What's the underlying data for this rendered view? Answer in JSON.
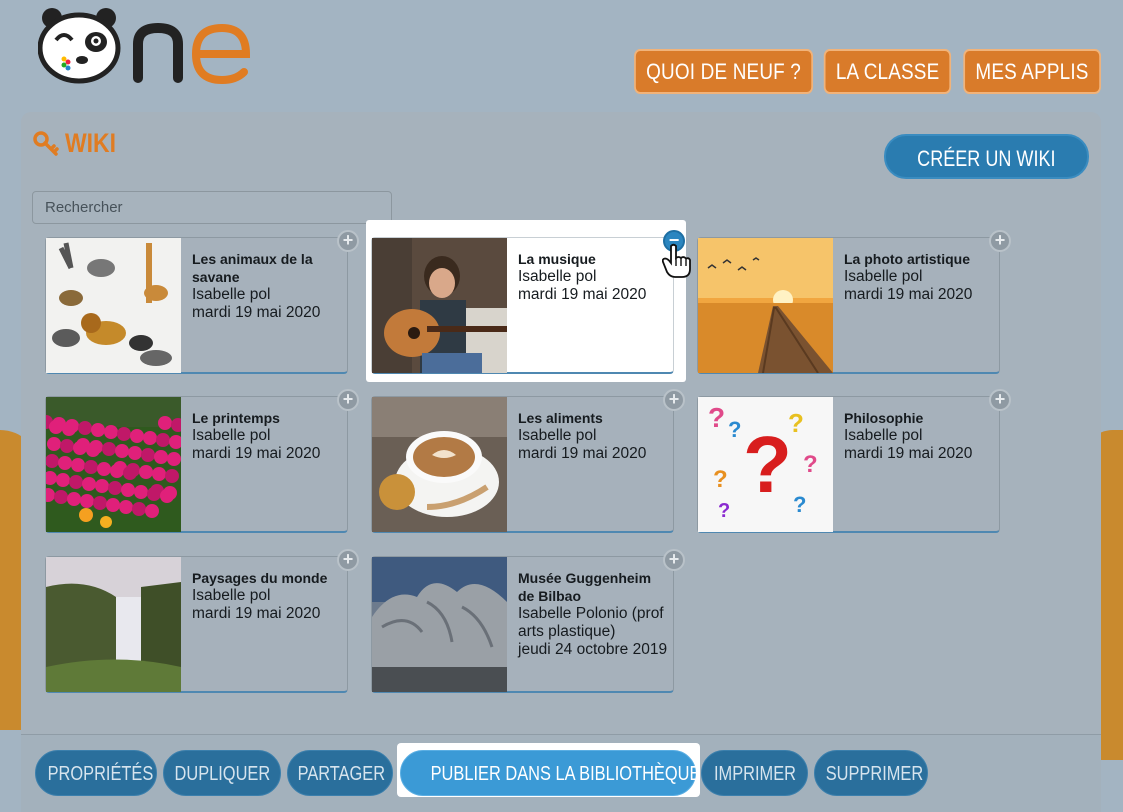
{
  "logo": {
    "text": "One"
  },
  "nav": [
    {
      "label": "QUOI DE NEUF ?"
    },
    {
      "label": "LA CLASSE"
    },
    {
      "label": "MES APPLIS"
    }
  ],
  "page": {
    "title": "WIKI",
    "create_button": "CRÉER UN WIKI",
    "search_placeholder": "Rechercher"
  },
  "cards": [
    {
      "title": "Les animaux de la savane",
      "author": "Isabelle pol",
      "date": "mardi 19 mai 2020",
      "thumb": "animals",
      "selected": false
    },
    {
      "title": "La musique",
      "author": "Isabelle pol",
      "date": "mardi 19 mai 2020",
      "thumb": "guitar",
      "selected": true
    },
    {
      "title": "La photo artistique",
      "author": "Isabelle pol",
      "date": "mardi 19 mai 2020",
      "thumb": "sunset",
      "selected": false
    },
    {
      "title": "Le printemps",
      "author": "Isabelle pol",
      "date": "mardi 19 mai 2020",
      "thumb": "flowers",
      "selected": false
    },
    {
      "title": "Les aliments",
      "author": "Isabelle pol",
      "date": "mardi 19 mai 2020",
      "thumb": "coffee",
      "selected": false
    },
    {
      "title": "Philosophie",
      "author": "Isabelle pol",
      "date": "mardi 19 mai 2020",
      "thumb": "questions",
      "selected": false
    },
    {
      "title": "Paysages du monde",
      "author": "Isabelle pol",
      "date": "mardi 19 mai 2020",
      "thumb": "waterfall",
      "selected": false
    },
    {
      "title": "Musée Guggenheim de Bilbao",
      "author": "Isabelle Polonio (prof arts plastique)",
      "date": "jeudi 24 octobre 2019",
      "thumb": "museum",
      "selected": false
    }
  ],
  "toolbar": [
    {
      "label": "PROPRIÉTÉS"
    },
    {
      "label": "DUPLIQUER"
    },
    {
      "label": "PARTAGER"
    },
    {
      "label": "PUBLIER DANS LA BIBLIOTHÈQUE"
    },
    {
      "label": "IMPRIMER"
    },
    {
      "label": "SUPPRIMER"
    }
  ],
  "colors": {
    "accent_orange": "#d97b2a",
    "action_blue": "#2a6f9c",
    "highlight_blue": "#3b9ad6"
  }
}
